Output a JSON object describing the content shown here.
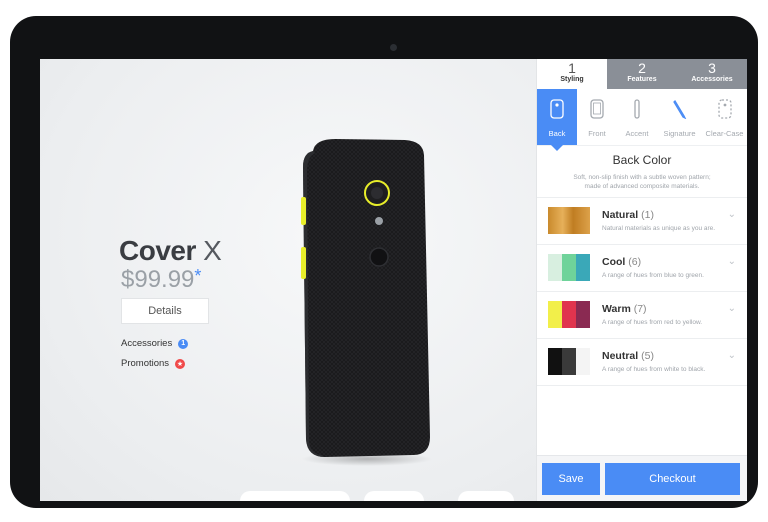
{
  "product": {
    "name_bold": "Cover",
    "name_light": "X",
    "price": "$99.99",
    "price_mark": "*",
    "details_label": "Details",
    "links": [
      {
        "label": "Accessories",
        "badge": "1",
        "color": "#4a8cf5"
      },
      {
        "label": "Promotions",
        "badge": "★",
        "color": "#f04949"
      }
    ]
  },
  "steps": [
    {
      "num": "1",
      "label": "Styling",
      "active": true
    },
    {
      "num": "2",
      "label": "Features",
      "active": false
    },
    {
      "num": "3",
      "label": "Accessories",
      "active": false
    }
  ],
  "style_tabs": [
    {
      "label": "Back",
      "icon": "phone-back-icon",
      "active": true
    },
    {
      "label": "Front",
      "icon": "phone-front-icon",
      "active": false
    },
    {
      "label": "Accent",
      "icon": "accent-icon",
      "active": false
    },
    {
      "label": "Signature",
      "icon": "pen-icon",
      "active": false
    },
    {
      "label": "Clear-Case",
      "icon": "case-icon",
      "active": false
    }
  ],
  "section": {
    "title": "Back Color",
    "description": "Soft, non-slip finish with a subtle woven pattern; made of advanced composite materials."
  },
  "options": [
    {
      "name": "Natural",
      "count": "(1)",
      "desc": "Natural materials as unique as you are.",
      "colors": [
        "#c98a2c",
        "#e0a646",
        "#c98a2c"
      ]
    },
    {
      "name": "Cool",
      "count": "(6)",
      "desc": "A range of hues from blue to green.",
      "colors": [
        "#d8efe0",
        "#6fd39a",
        "#3aa8b8"
      ]
    },
    {
      "name": "Warm",
      "count": "(7)",
      "desc": "A range of hues from red to yellow.",
      "colors": [
        "#f2ef4a",
        "#e0344e",
        "#8a2a52"
      ]
    },
    {
      "name": "Neutral",
      "count": "(5)",
      "desc": "A range of hues from white to black.",
      "colors": [
        "#111111",
        "#3a3a3a",
        "#f4f4f4"
      ]
    }
  ],
  "actions": {
    "save": "Save",
    "checkout": "Checkout"
  },
  "colors": {
    "accent": "#4a8cf5",
    "step_inactive": "#8a8f97",
    "phone_accent": "#e8ee2a"
  }
}
